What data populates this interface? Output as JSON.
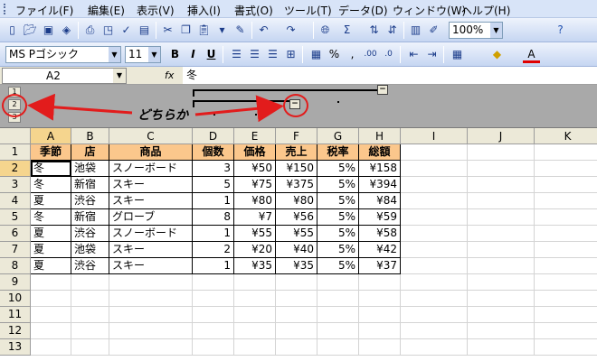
{
  "menu": [
    "ファイル(F)",
    "編集(E)",
    "表示(V)",
    "挿入(I)",
    "書式(O)",
    "ツール(T)",
    "データ(D)",
    "ウィンドウ(W)",
    "ヘルプ(H)"
  ],
  "toolbar": {
    "zoom": "100%",
    "font_name": "MS Pゴシック",
    "font_size": "11",
    "icons": [
      "new-icon",
      "open-icon",
      "save-icon",
      "permission-icon",
      "email-icon",
      "print-icon",
      "print-preview-icon",
      "spelling-icon",
      "research-icon",
      "cut-icon",
      "copy-icon",
      "paste-icon",
      "format-painter-icon",
      "undo-icon",
      "redo-icon",
      "hyperlink-icon",
      "autosum-icon",
      "sort-ascending-icon",
      "sort-descending-icon",
      "chart-wizard-icon",
      "drawing-icon",
      "help-icon"
    ],
    "format_labels": {
      "bold": "B",
      "italic": "I",
      "underline": "U",
      "percent": "%",
      "comma": ",",
      "sigma": "Σ"
    }
  },
  "formula_bar": {
    "name_box": "A2",
    "fx_label": "fx",
    "content": "冬"
  },
  "outline": {
    "levels": [
      "1",
      "2",
      "3"
    ],
    "collapse_label": "−",
    "annotation": "どちらか",
    "annotation_color": "#e21c1c"
  },
  "grid": {
    "columns": [
      "A",
      "B",
      "C",
      "D",
      "E",
      "F",
      "G",
      "H",
      "I",
      "J",
      "K"
    ],
    "rows": [
      "1",
      "2",
      "3",
      "4",
      "5",
      "6",
      "7",
      "8",
      "9",
      "10",
      "11",
      "12",
      "13"
    ],
    "headers": [
      "季節",
      "店",
      "商品",
      "個数",
      "価格",
      "売上",
      "税率",
      "総額"
    ],
    "data": [
      [
        "冬",
        "池袋",
        "スノーボード",
        "3",
        "¥50",
        "¥150",
        "5%",
        "¥158"
      ],
      [
        "冬",
        "新宿",
        "スキー",
        "5",
        "¥75",
        "¥375",
        "5%",
        "¥394"
      ],
      [
        "夏",
        "渋谷",
        "スキー",
        "1",
        "¥80",
        "¥80",
        "5%",
        "¥84"
      ],
      [
        "冬",
        "新宿",
        "グローブ",
        "8",
        "¥7",
        "¥56",
        "5%",
        "¥59"
      ],
      [
        "夏",
        "渋谷",
        "スノーボード",
        "1",
        "¥55",
        "¥55",
        "5%",
        "¥58"
      ],
      [
        "夏",
        "池袋",
        "スキー",
        "2",
        "¥20",
        "¥40",
        "5%",
        "¥42"
      ],
      [
        "夏",
        "渋谷",
        "スキー",
        "1",
        "¥35",
        "¥35",
        "5%",
        "¥37"
      ]
    ],
    "header_color": "#fbc78c",
    "active_cell": "A2"
  }
}
